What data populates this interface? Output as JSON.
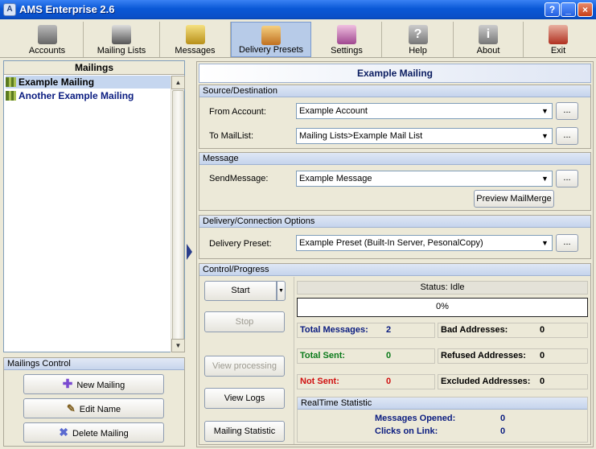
{
  "window": {
    "title": "AMS Enterprise 2.6",
    "app_icon": "app-icon",
    "buttons": [
      "?",
      "_",
      "×"
    ]
  },
  "toolbar": {
    "items": [
      {
        "label": "Accounts",
        "icon": "accounts-icon",
        "color": "#777777"
      },
      {
        "label": "Mailing Lists",
        "icon": "mailing-lists-icon",
        "color": "#555555"
      },
      {
        "label": "Messages",
        "icon": "messages-icon",
        "color": "#c8a020"
      },
      {
        "label": "Delivery Presets",
        "icon": "delivery-presets-icon",
        "color": "#d09030",
        "active": true
      },
      {
        "label": "Settings",
        "icon": "settings-icon",
        "color": "#b060a0"
      },
      {
        "label": "Help",
        "icon": "help-icon",
        "color": "#888888"
      },
      {
        "label": "About",
        "icon": "about-icon",
        "color": "#888888"
      },
      {
        "label": "Exit",
        "icon": "exit-icon",
        "color": "#c03020"
      }
    ]
  },
  "mailings": {
    "header": "Mailings",
    "items": [
      {
        "label": "Example Mailing",
        "selected": true
      },
      {
        "label": "Another Example Mailing",
        "selected": false
      }
    ]
  },
  "mailings_control": {
    "header": "Mailings Control",
    "new_label": "New Mailing",
    "edit_label": "Edit Name",
    "delete_label": "Delete Mailing"
  },
  "detail": {
    "title": "Example Mailing",
    "source": {
      "header": "Source/Destination",
      "from_label": "From Account:",
      "from_value": "Example Account",
      "to_label": "To MailList:",
      "to_value": "Mailing Lists>Example Mail List"
    },
    "message": {
      "header": "Message",
      "send_label": "SendMessage:",
      "send_value": "Example Message",
      "preview_label": "Preview MailMerge"
    },
    "delivery": {
      "header": "Delivery/Connection Options",
      "preset_label": "Delivery Preset:",
      "preset_value": "Example Preset (Built-In Server, PesonalCopy)"
    },
    "browse_label": "...",
    "control": {
      "header": "Control/Progress",
      "start_label": "Start",
      "stop_label": "Stop",
      "view_processing_label": "View processing",
      "view_logs_label": "View Logs",
      "mailing_statistic_label": "Mailing Statistic",
      "status": "Status: Idle",
      "progress_text": "0%",
      "progress": 0,
      "total_messages_label": "Total Messages:",
      "total_messages": "2",
      "total_sent_label": "Total Sent:",
      "total_sent": "0",
      "not_sent_label": "Not Sent:",
      "not_sent": "0",
      "bad_label": "Bad Addresses:",
      "bad": "0",
      "refused_label": "Refused Addresses:",
      "refused": "0",
      "excluded_label": "Excluded Addresses:",
      "excluded": "0",
      "realtime_header": "RealTime Statistic",
      "opened_label": "Messages Opened:",
      "opened": "0",
      "clicks_label": "Clicks on Link:",
      "clicks": "0"
    }
  },
  "colors": {
    "accent": "#0a58d6",
    "total_messages": "#0a1c80",
    "total_sent": "#0a7a1a",
    "not_sent": "#d01010"
  }
}
